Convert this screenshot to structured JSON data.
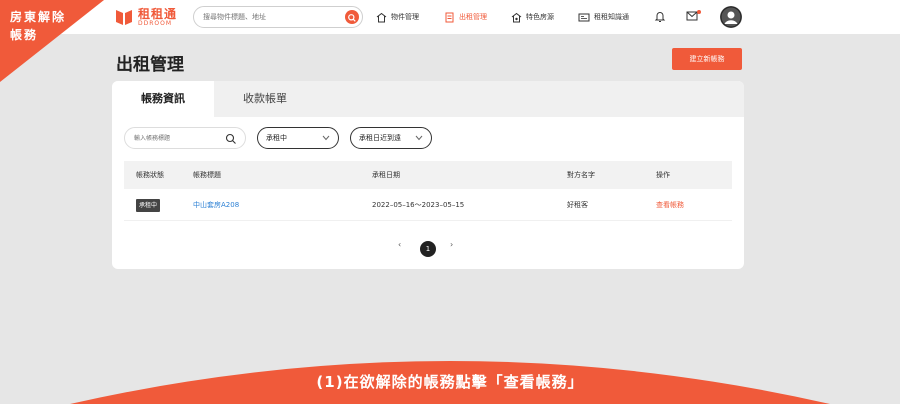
{
  "ribbon": {
    "line1": "房東解除",
    "line2": "帳務"
  },
  "logo": {
    "name": "租租通",
    "sub": "DDROOM"
  },
  "search": {
    "placeholder": "搜尋物件標題、地址"
  },
  "nav": [
    {
      "label": "物件管理",
      "icon": "house-icon",
      "active": false
    },
    {
      "label": "出租管理",
      "icon": "document-icon",
      "active": true
    },
    {
      "label": "特色房源",
      "icon": "star-house-icon",
      "active": false
    },
    {
      "label": "租租知識通",
      "icon": "book-icon",
      "active": false
    }
  ],
  "page": {
    "title": "出租管理",
    "create_label": "建立新帳務"
  },
  "tabs": [
    {
      "label": "帳務資訊",
      "active": true
    },
    {
      "label": "收款帳單",
      "active": false
    }
  ],
  "filters": {
    "search_placeholder": "輸入帳務標題",
    "status_value": "承租中",
    "sort_value": "承租日近到遠"
  },
  "table": {
    "headers": [
      "帳務狀態",
      "帳務標題",
      "承租日期",
      "對方名字",
      "操作"
    ],
    "rows": [
      {
        "status": "承租中",
        "title": "中山套房A208",
        "dates": "2022–05–16～2023–05–15",
        "name": "好租客",
        "action": "查看帳務"
      }
    ]
  },
  "pagination": {
    "prev": "‹",
    "current": "1",
    "next": "›"
  },
  "banner": {
    "text": "(1)在欲解除的帳務點擊「查看帳務」"
  },
  "colors": {
    "accent": "#f05a3a",
    "link": "#2a7fd4"
  }
}
